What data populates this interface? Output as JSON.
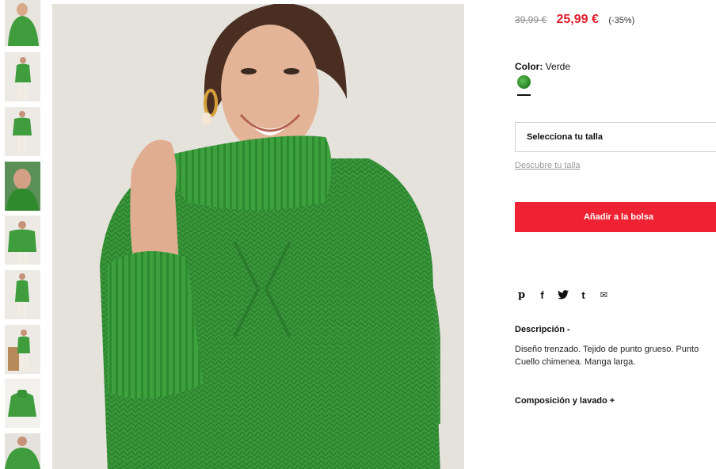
{
  "gallery": {
    "thumbnails": [
      {
        "alt": "thumb-1"
      },
      {
        "alt": "thumb-2"
      },
      {
        "alt": "thumb-3"
      },
      {
        "alt": "thumb-4"
      },
      {
        "alt": "thumb-5"
      },
      {
        "alt": "thumb-6"
      },
      {
        "alt": "thumb-7"
      },
      {
        "alt": "thumb-8"
      },
      {
        "alt": "thumb-9"
      }
    ]
  },
  "product": {
    "old_price": "39,99 €",
    "new_price": "25,99 €",
    "discount": "(-35%)",
    "color_label": "Color:",
    "color_value": "Verde",
    "size_select": "Selecciona tu talla",
    "size_guide": "Descubre tu talla",
    "add_to_bag": "Añadir a la bolsa",
    "description_title": "Descripción  -",
    "description_lines": [
      "Diseño trenzado. Tejido de punto grueso. Punto",
      "Cuello chimenea. Manga larga."
    ],
    "composition_title": "Composición y lavado  +"
  },
  "share": {
    "pinterest": "p",
    "facebook": "f",
    "twitter": "t",
    "tumblr": "t",
    "email": "✉"
  },
  "colors": {
    "accent": "#ee2233",
    "price_red": "#e11d2a",
    "sweater_green": "#3a9a3a"
  }
}
